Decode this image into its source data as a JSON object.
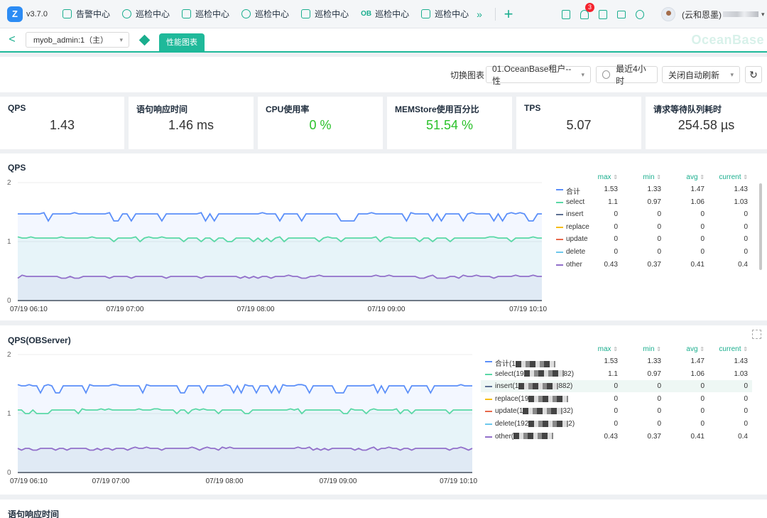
{
  "app": {
    "version": "v3.7.0",
    "brand": "OceanBase"
  },
  "nav": {
    "items": [
      {
        "label": "告警中心",
        "icon": "alert-icon"
      },
      {
        "label": "巡检中心",
        "icon": "inspect-icon"
      },
      {
        "label": "巡检中心",
        "icon": "inspect-icon"
      },
      {
        "label": "巡检中心",
        "icon": "inspect-icon"
      },
      {
        "label": "巡检中心",
        "icon": "shield-icon"
      },
      {
        "label": "巡检中心",
        "icon": "ob-icon",
        "glyph": "OB"
      },
      {
        "label": "巡检中心",
        "icon": "hex-icon"
      }
    ],
    "more": "»",
    "add": "+",
    "notification_count": "3",
    "user": "(云和恩墨)"
  },
  "subbar": {
    "back": "<",
    "tenant": "myob_admin:1（主）",
    "active_tab": "性能图表"
  },
  "toolbar": {
    "switch_label": "切换图表",
    "chart_select": "01.OceanBase租户--性",
    "time_range": "最近4小时",
    "auto_refresh": "关闭自动刷新"
  },
  "stats": [
    {
      "title": "QPS",
      "value": "1.43",
      "status": "normal"
    },
    {
      "title": "语句响应时间",
      "value": "1.46 ms",
      "status": "normal"
    },
    {
      "title": "CPU使用率",
      "value": "0 %",
      "status": "good"
    },
    {
      "title": "MEMStore使用百分比",
      "value": "51.54 %",
      "status": "good"
    },
    {
      "title": "TPS",
      "value": "5.07",
      "status": "normal"
    },
    {
      "title": "请求等待队列耗时",
      "value": "254.58 µs",
      "status": "normal"
    }
  ],
  "legend_columns": [
    "max",
    "min",
    "avg",
    "current"
  ],
  "panels": [
    {
      "title": "QPS",
      "chart_data": {
        "type": "line",
        "ylim": [
          0,
          2
        ],
        "yticks": [
          "0",
          "1",
          "2"
        ],
        "xticks": [
          "07/19 06:10",
          "07/19 07:00",
          "07/19 08:00",
          "07/19 09:00",
          "07/19 10:10"
        ],
        "series": [
          {
            "name": "合计",
            "color": "#5b8ff9",
            "max": "1.53",
            "min": "1.33",
            "avg": "1.47",
            "current": "1.43",
            "level": 1.47
          },
          {
            "name": "select",
            "color": "#5ad8a6",
            "max": "1.1",
            "min": "0.97",
            "avg": "1.06",
            "current": "1.03",
            "level": 1.06
          },
          {
            "name": "insert",
            "color": "#5d7092",
            "max": "0",
            "min": "0",
            "avg": "0",
            "current": "0",
            "level": 0
          },
          {
            "name": "replace",
            "color": "#f6bd16",
            "max": "0",
            "min": "0",
            "avg": "0",
            "current": "0",
            "level": 0
          },
          {
            "name": "update",
            "color": "#e8684a",
            "max": "0",
            "min": "0",
            "avg": "0",
            "current": "0",
            "level": 0
          },
          {
            "name": "delete",
            "color": "#6dc8ec",
            "max": "0",
            "min": "0",
            "avg": "0",
            "current": "0",
            "level": 0
          },
          {
            "name": "other",
            "color": "#9270ca",
            "max": "0.43",
            "min": "0.37",
            "avg": "0.41",
            "current": "0.4",
            "level": 0.41
          }
        ]
      }
    },
    {
      "title": "QPS(OBServer)",
      "chart_data": {
        "type": "line",
        "ylim": [
          0,
          2
        ],
        "yticks": [
          "0",
          "1",
          "2"
        ],
        "xticks": [
          "07/19 06:10",
          "07/19 07:00",
          "07/19 08:00",
          "07/19 09:00",
          "07/19 10:10"
        ],
        "series": [
          {
            "name": "合计(1",
            "suffix": "",
            "color": "#5b8ff9",
            "max": "1.53",
            "min": "1.33",
            "avg": "1.47",
            "current": "1.43",
            "level": 1.47
          },
          {
            "name": "select(19",
            "suffix": "82)",
            "color": "#5ad8a6",
            "max": "1.1",
            "min": "0.97",
            "avg": "1.06",
            "current": "1.03",
            "level": 1.06
          },
          {
            "name": "insert(1",
            "suffix": "882)",
            "color": "#5d7092",
            "max": "0",
            "min": "0",
            "avg": "0",
            "current": "0",
            "level": 0
          },
          {
            "name": "replace(19",
            "suffix": "",
            "color": "#f6bd16",
            "max": "0",
            "min": "0",
            "avg": "0",
            "current": "0",
            "level": 0
          },
          {
            "name": "update(1",
            "suffix": "32)",
            "color": "#e8684a",
            "max": "0",
            "min": "0",
            "avg": "0",
            "current": "0",
            "level": 0
          },
          {
            "name": "delete(192",
            "suffix": "2)",
            "color": "#6dc8ec",
            "max": "0",
            "min": "0",
            "avg": "0",
            "current": "0",
            "level": 0
          },
          {
            "name": "other(",
            "suffix": "",
            "color": "#9270ca",
            "max": "0.43",
            "min": "0.37",
            "avg": "0.41",
            "current": "0.4",
            "level": 0.41
          }
        ]
      }
    },
    {
      "title": "语句响应时间"
    }
  ]
}
